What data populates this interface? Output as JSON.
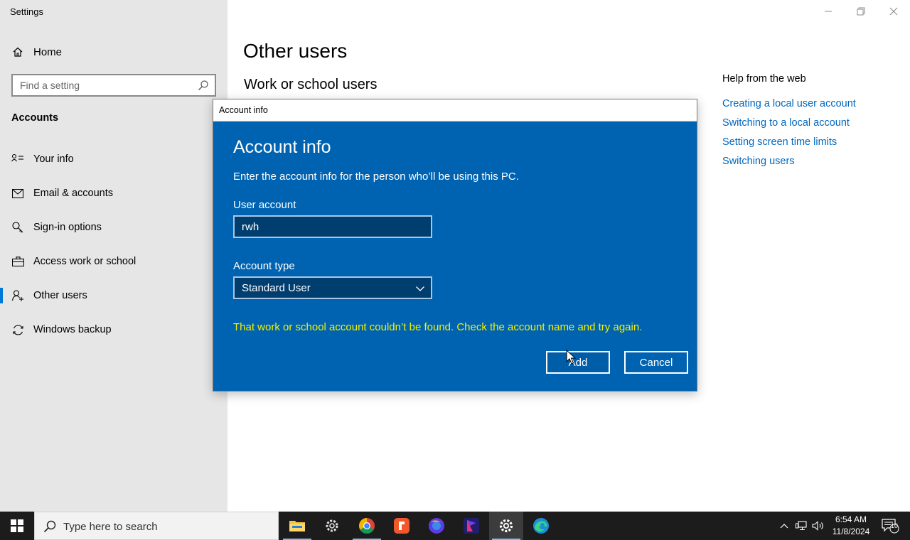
{
  "window": {
    "title": "Settings"
  },
  "sidebar": {
    "home_label": "Home",
    "search_placeholder": "Find a setting",
    "section_header": "Accounts",
    "items": [
      {
        "label": "Your info",
        "icon": "person-card-icon"
      },
      {
        "label": "Email & accounts",
        "icon": "mail-icon"
      },
      {
        "label": "Sign-in options",
        "icon": "key-icon"
      },
      {
        "label": "Access work or school",
        "icon": "briefcase-icon"
      },
      {
        "label": "Other users",
        "icon": "person-add-icon",
        "selected": true
      },
      {
        "label": "Windows backup",
        "icon": "sync-icon"
      }
    ]
  },
  "main": {
    "page_title": "Other users",
    "subheading": "Work or school users",
    "help": {
      "title": "Help from the web",
      "links": [
        "Creating a local user account",
        "Switching to a local account",
        "Setting screen time limits",
        "Switching users"
      ]
    }
  },
  "dialog": {
    "title_bar": "Account info",
    "heading": "Account info",
    "description": "Enter the account info for the person who’ll be using this PC.",
    "user_account_label": "User account",
    "user_account_value": "rwh",
    "account_type_label": "Account type",
    "account_type_value": "Standard User",
    "error": "That work or school account couldn’t be found. Check the account name and try again.",
    "add_label": "Add",
    "cancel_label": "Cancel"
  },
  "taskbar": {
    "search_placeholder": "Type here to search",
    "apps": [
      "file-explorer-icon",
      "settings-gear-icon",
      "chrome-icon",
      "red-app-icon",
      "firefox-icon",
      "purple-app-icon",
      "settings-active-icon",
      "edge-icon"
    ],
    "time": "6:54 AM",
    "date": "11/8/2024",
    "notification_count": "10"
  },
  "colors": {
    "accent": "#0078d7",
    "dialog_bg": "#0063b1",
    "error_text": "#f1f100",
    "link": "#0067c0"
  }
}
